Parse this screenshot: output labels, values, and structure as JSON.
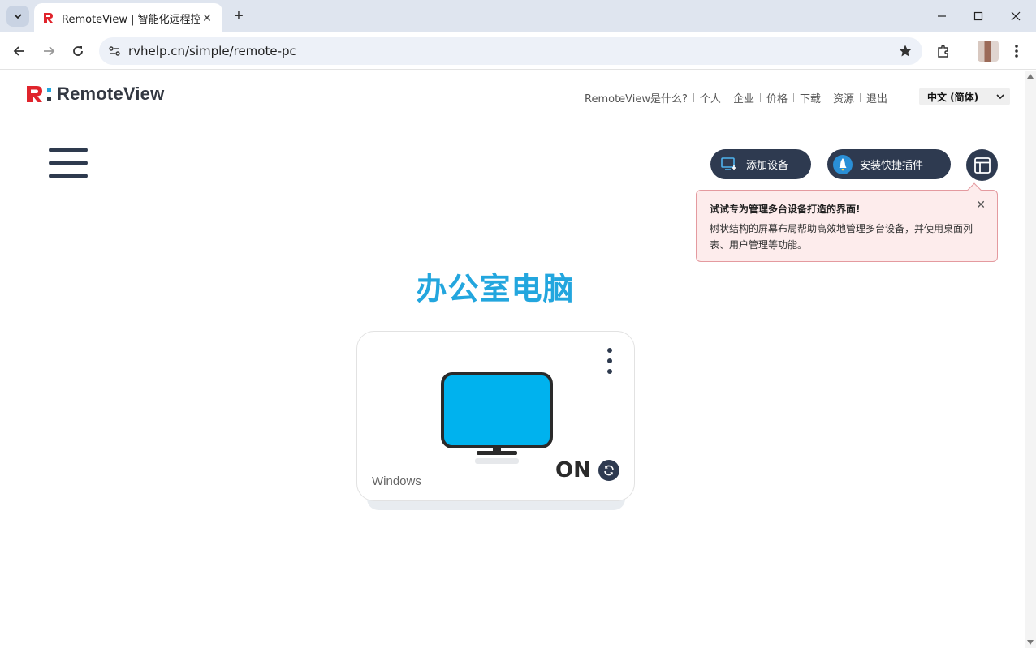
{
  "browser": {
    "tab_title": "RemoteView | 智能化远程控制",
    "url": "rvhelp.cn/simple/remote-pc"
  },
  "header": {
    "logo_text": "RemoteView",
    "nav": [
      {
        "label": "RemoteView是什么?"
      },
      {
        "label": "个人"
      },
      {
        "label": "企业"
      },
      {
        "label": "价格"
      },
      {
        "label": "下载"
      },
      {
        "label": "资源"
      },
      {
        "label": "退出"
      }
    ],
    "language": "中文 (简体)"
  },
  "actions": {
    "add_device": "添加设备",
    "install_plugin": "安装快捷插件"
  },
  "tip": {
    "title": "试试专为管理多台设备打造的界面!",
    "body": "树状结构的屏幕布局帮助高效地管理多台设备，并使用桌面列表、用户管理等功能。"
  },
  "device": {
    "group_title": "办公室电脑",
    "os": "Windows",
    "status": "ON"
  },
  "colors": {
    "brand_blue": "#23a6de",
    "monitor_screen": "#00b2ee",
    "dark_button": "#2e3a50",
    "logo_red": "#e0242c",
    "tip_bg": "#fdecec",
    "tip_border": "#e49a9f"
  },
  "icons": {
    "add_device": "monitor-plus-icon",
    "install_plugin": "rocket-icon",
    "layout_switch": "layout-panel-icon",
    "refresh": "refresh-icon"
  }
}
